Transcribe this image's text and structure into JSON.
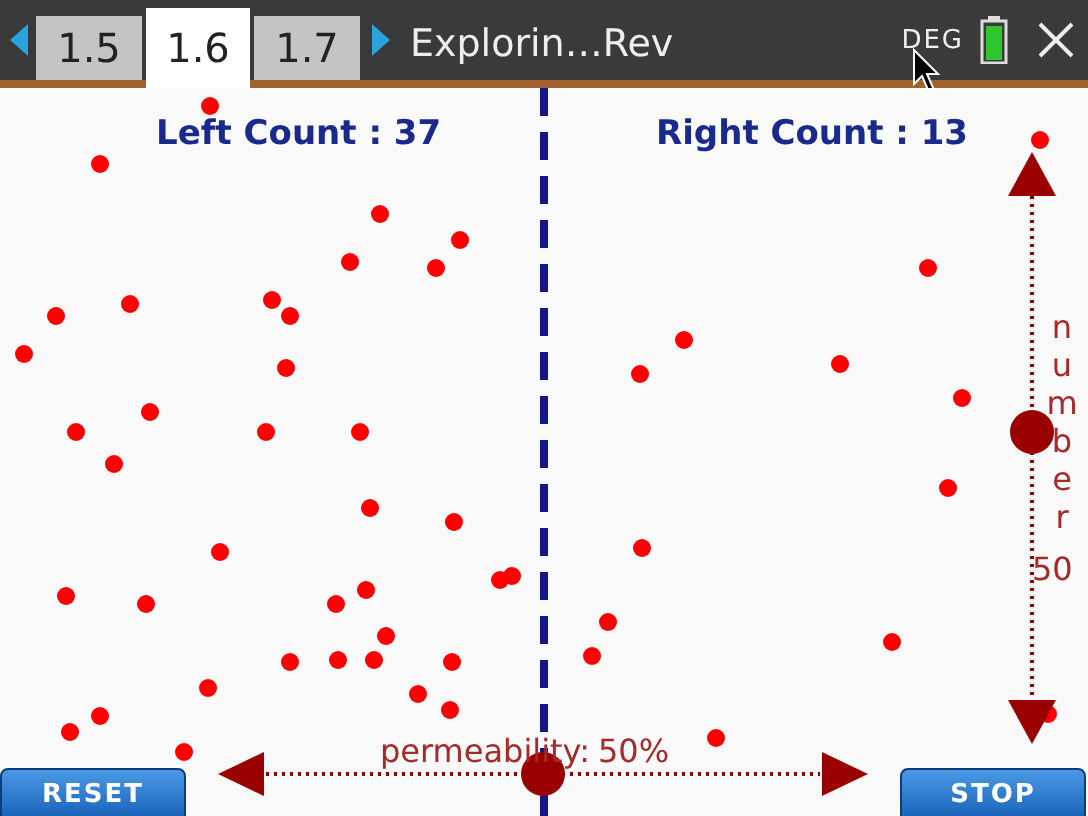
{
  "tabs": [
    {
      "label": "1.5",
      "selected": false
    },
    {
      "label": "1.6",
      "selected": true
    },
    {
      "label": "1.7",
      "selected": false
    }
  ],
  "document_title": "Explorin…Rev",
  "angle_mode": "DEG",
  "left_count": "Left Count : 37",
  "right_count": "Right Count : 13",
  "number_slider": {
    "label": "number",
    "value": "50",
    "level": 0.5
  },
  "permeability_slider": {
    "label": "permeability:",
    "value": "50%",
    "level": 0.5
  },
  "buttons": [
    "RESET",
    "STOP"
  ]
}
